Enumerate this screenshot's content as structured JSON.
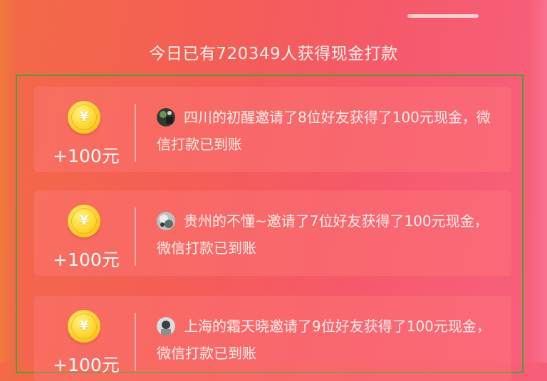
{
  "header": {
    "handle": "drag-handle",
    "headline": "今日已有720349人获得现金打款"
  },
  "records": [
    {
      "coin_symbol": "¥",
      "amount": "+100元",
      "avatar": "user-avatar-dark",
      "message": "四川的初醒邀请了8位好友获得了100元现金，微信打款已到账"
    },
    {
      "coin_symbol": "¥",
      "amount": "+100元",
      "avatar": "user-avatar-light",
      "message": "贵州的不懂~邀请了7位好友获得了100元现金，微信打款已到账"
    },
    {
      "coin_symbol": "¥",
      "amount": "+100元",
      "avatar": "user-avatar-grey",
      "message": "上海的霜天晓邀请了9位好友获得了100元现金，微信打款已到账"
    }
  ],
  "colors": {
    "background_start": "#f26a46",
    "background_end": "#f8607f",
    "coin": "#ffd93a",
    "text": "#ffffff",
    "frame": "#3fa72e"
  }
}
